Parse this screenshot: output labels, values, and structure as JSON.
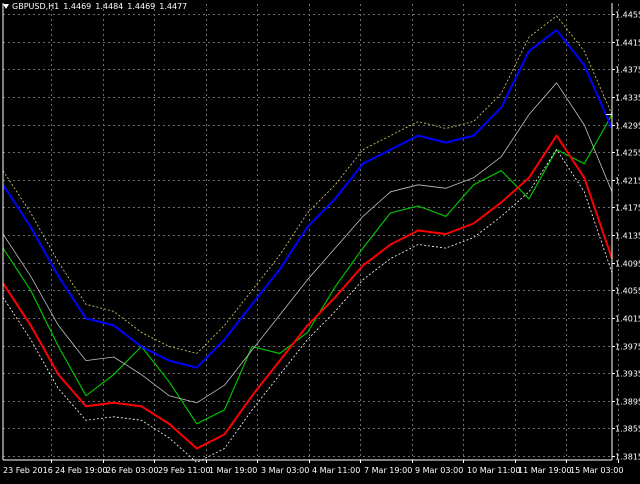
{
  "header": {
    "menu_icon": "triangle-down-icon",
    "symbol_label": "GBPUSD,H1",
    "ohlc": [
      "1.4469",
      "1.4484",
      "1.4469",
      "1.4477"
    ]
  },
  "colors": {
    "background": "#000000",
    "grid": "#6b6b6b",
    "axis": "#ffffff",
    "price_line": "#00c000",
    "upper_band": "#0000ff",
    "lower_band": "#ff0000",
    "outer_band_top": "#d8d870",
    "outer_band_bottom": "#ffffff",
    "middle_line": "#bfbfbf"
  },
  "chart_data": {
    "type": "line",
    "symbol": "GBPUSD",
    "timeframe": "H1",
    "ylim": [
      1.3815,
      1.4455
    ],
    "y_ticks": [
      "1.4455",
      "1.4415",
      "1.4375",
      "1.4335",
      "1.4295",
      "1.4255",
      "1.4215",
      "1.4175",
      "1.4135",
      "1.4095",
      "1.4055",
      "1.4015",
      "1.3975",
      "1.3935",
      "1.3895",
      "1.3855",
      "1.3815"
    ],
    "x_ticks": [
      "23 Feb 2016",
      "24 Feb 19:00",
      "26 Feb 03:00",
      "29 Feb 11:00",
      "1 Mar 19:00",
      "3 Mar 03:00",
      "4 Mar 11:00",
      "7 Mar 19:00",
      "9 Mar 03:00",
      "10 Mar 11:00",
      "11 Mar 19:00",
      "15 Mar 03:00"
    ],
    "x": [
      0,
      2,
      4,
      6,
      8,
      10,
      12,
      14,
      16,
      18,
      20,
      22,
      24,
      26,
      28,
      30,
      32,
      34,
      36,
      38,
      40,
      42,
      44
    ],
    "series": [
      {
        "values": [
          1.4115,
          1.4055,
          1.3975,
          1.3905,
          1.3935,
          1.3975,
          1.3925,
          1.3865,
          1.3885,
          1.3975,
          1.3965,
          1.3995,
          1.406,
          1.4115,
          1.4165,
          1.4175,
          1.416,
          1.4205,
          1.4225,
          1.4185,
          1.4255,
          1.4235,
          1.4305
        ]
      },
      {
        "values": [
          1.4205,
          1.4145,
          1.4075,
          1.4015,
          1.4005,
          1.3975,
          1.3955,
          1.3945,
          1.3985,
          1.4035,
          1.4085,
          1.4145,
          1.4185,
          1.4235,
          1.4255,
          1.4275,
          1.4265,
          1.4275,
          1.4315,
          1.4395,
          1.4425,
          1.4375,
          1.4285
        ]
      },
      {
        "values": [
          1.4135,
          1.4075,
          1.4005,
          1.3955,
          1.396,
          1.3935,
          1.3905,
          1.3895,
          1.392,
          1.397,
          1.402,
          1.407,
          1.4115,
          1.416,
          1.4195,
          1.4205,
          1.42,
          1.4215,
          1.4245,
          1.4305,
          1.435,
          1.429,
          1.4195
        ]
      },
      {
        "values": [
          1.4065,
          1.4005,
          1.3935,
          1.389,
          1.3895,
          1.389,
          1.3865,
          1.383,
          1.385,
          1.3905,
          1.3955,
          1.4005,
          1.4045,
          1.409,
          1.412,
          1.414,
          1.4135,
          1.415,
          1.418,
          1.4215,
          1.4275,
          1.4215,
          1.41
        ]
      },
      {
        "values": [
          1.4225,
          1.4165,
          1.4095,
          1.4035,
          1.4025,
          1.3995,
          1.3975,
          1.3965,
          1.4005,
          1.4055,
          1.4105,
          1.4165,
          1.4205,
          1.4255,
          1.4275,
          1.4295,
          1.4285,
          1.4295,
          1.4335,
          1.4415,
          1.4445,
          1.4395,
          1.4305
        ]
      },
      {
        "values": [
          1.4045,
          1.3985,
          1.3915,
          1.387,
          1.3875,
          1.387,
          1.3845,
          1.381,
          1.383,
          1.3885,
          1.3935,
          1.3985,
          1.4025,
          1.407,
          1.41,
          1.412,
          1.4115,
          1.413,
          1.416,
          1.4195,
          1.4255,
          1.4195,
          1.408
        ]
      }
    ]
  }
}
